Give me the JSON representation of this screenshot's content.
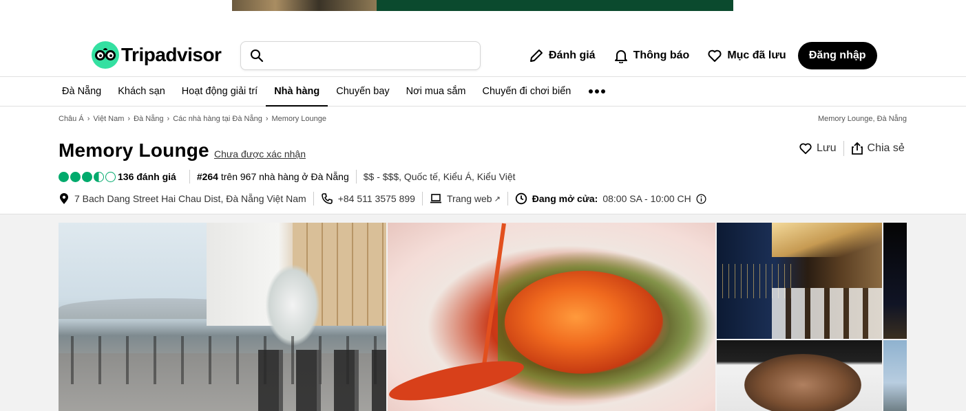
{
  "ad": {
    "colors": {
      "green": "#0b4a2e"
    }
  },
  "header": {
    "logo_text": "Tripadvisor",
    "search": {
      "value": "",
      "placeholder": ""
    },
    "actions": [
      {
        "label": "Đánh giá",
        "icon": "pencil-icon"
      },
      {
        "label": "Thông báo",
        "icon": "bell-icon"
      },
      {
        "label": "Mục đã lưu",
        "icon": "heart-icon"
      }
    ],
    "login_label": "Đăng nhập"
  },
  "nav": {
    "items": [
      {
        "label": "Đà Nẵng",
        "active": false
      },
      {
        "label": "Khách sạn",
        "active": false
      },
      {
        "label": "Hoạt động giải trí",
        "active": false
      },
      {
        "label": "Nhà hàng",
        "active": true
      },
      {
        "label": "Chuyến bay",
        "active": false
      },
      {
        "label": "Nơi mua sắm",
        "active": false
      },
      {
        "label": "Chuyến đi chơi biển",
        "active": false
      }
    ],
    "more_icon": "more-dots-icon"
  },
  "breadcrumb": {
    "items": [
      "Châu Á",
      "Việt Nam",
      "Đà Nẵng",
      "Các nhà hàng tại Đà Nẵng",
      "Memory Lounge"
    ],
    "right": "Memory Lounge, Đà Nẵng"
  },
  "restaurant": {
    "name": "Memory Lounge",
    "claim_status": "Chưa được xác nhận",
    "save_label": "Lưu",
    "share_label": "Chia sẻ",
    "rating": 3.5,
    "rating_max": 5,
    "reviews_label": "136 đánh giá",
    "rank_number": "#264",
    "rank_text": " trên 967 nhà hàng ở Đà Nẵng",
    "price_cuisine": "$$ - $$$, Quốc tế, Kiểu Á, Kiểu Việt",
    "address": "7 Bach Dang Street Hai Chau Dist, Đà Nẵng Việt Nam",
    "phone": "+84 511 3575 899",
    "website_label": "Trang web",
    "hours_label": "Đang mở cửa:",
    "hours_value": "08:00 SA - 10:00 CH"
  },
  "colors": {
    "brand_green": "#34e0a1",
    "rating_green": "#00aa6c",
    "text": "#000000"
  }
}
